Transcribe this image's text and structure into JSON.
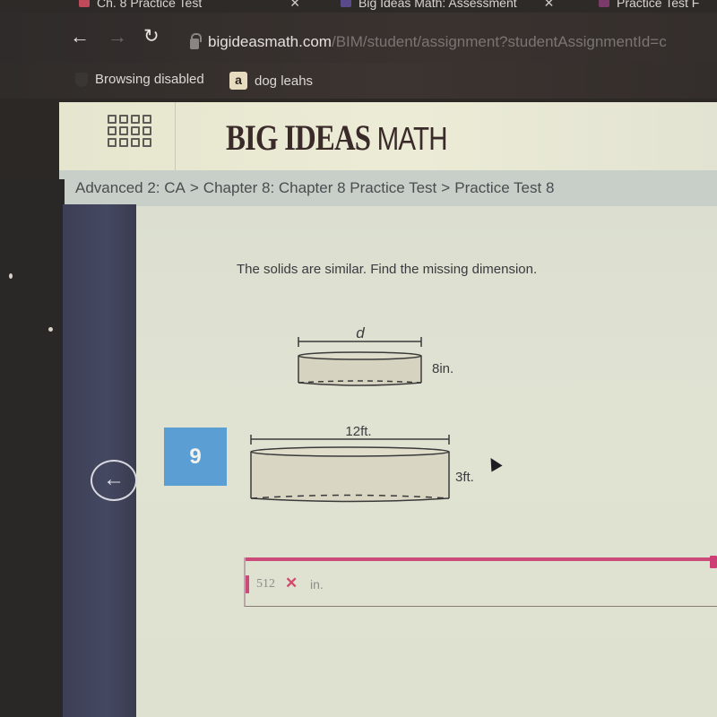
{
  "browser": {
    "tabs": [
      {
        "label": "Ch. 8 Practice Test",
        "favicon_color": "#c04a5a"
      },
      {
        "label": "Big Ideas Math: Assessment",
        "favicon_color": "#5a4a8a"
      },
      {
        "label": "Practice Test F",
        "favicon_color": "#7a3a6a"
      }
    ],
    "url_host": "bigideasmath.com",
    "url_path": "/BIM/student/assignment?studentAssignmentId=c",
    "bookmarks": [
      {
        "label": "Browsing disabled",
        "icon": "shield-icon"
      },
      {
        "label": "dog leahs",
        "icon": "amazon-icon",
        "icon_glyph": "a"
      }
    ]
  },
  "header": {
    "brand_bold": "BIG IDEAS ",
    "brand_thin": "MATH"
  },
  "breadcrumb": [
    "Advanced 2: CA",
    "Chapter 8: Chapter 8 Practice Test",
    "Practice Test 8"
  ],
  "breadcrumb_separator": ">",
  "question": {
    "number": "9",
    "prompt": "The solids are similar. Find the missing dimension.",
    "small_solid": {
      "diameter_label": "d",
      "height_label": "8in."
    },
    "large_solid": {
      "diameter_label": "12ft.",
      "height_label": "3ft."
    }
  },
  "answer": {
    "value": "512",
    "status": "incorrect",
    "status_glyph": "✕",
    "unit": "in.",
    "accent_color": "#cc4a7a"
  },
  "nav": {
    "back_glyph": "←"
  },
  "colors": {
    "question_badge": "#5b9ed3",
    "sidebar": "#41445c"
  }
}
